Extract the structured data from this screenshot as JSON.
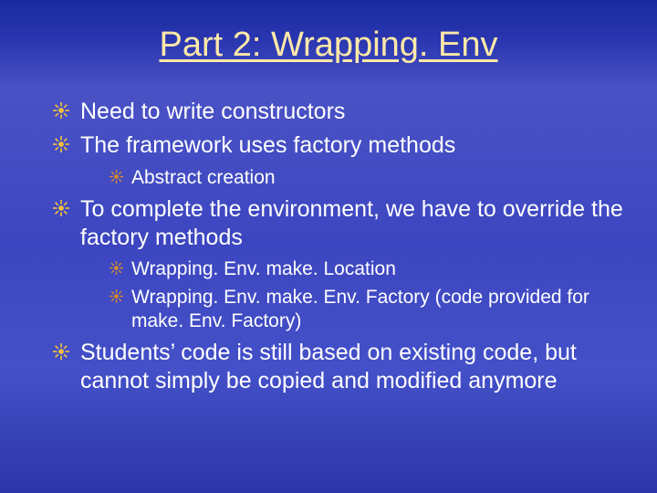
{
  "title": "Part 2: Wrapping. Env",
  "bullets": {
    "b1": "Need to write constructors",
    "b2": "The framework uses factory methods",
    "b2_1": "Abstract creation",
    "b3": "To complete the environment, we have to override the factory methods",
    "b3_1": "Wrapping. Env. make. Location",
    "b3_2": "Wrapping. Env. make. Env. Factory (code provided for make. Env. Factory)",
    "b4": "Students’ code is still based on existing code, but cannot simply be copied and modified anymore"
  }
}
